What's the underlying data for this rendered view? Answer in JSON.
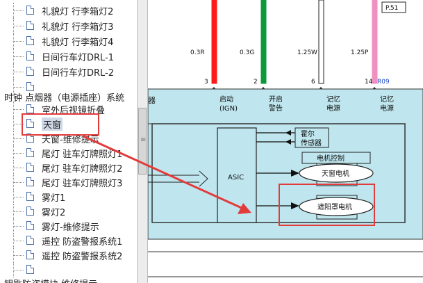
{
  "tree": {
    "items": [
      {
        "label": "礼貌灯 行李箱灯2"
      },
      {
        "label": "礼貌灯 行李箱灯3"
      },
      {
        "label": "礼貌灯 行李箱灯4"
      },
      {
        "label": "日间行车灯DRL-1"
      },
      {
        "label": "日间行车灯DRL-2"
      },
      {
        "label": ""
      }
    ],
    "category": "时钟 点烟器（电源插座）系统",
    "items2": [
      {
        "label": "室外后视镜折叠"
      },
      {
        "label": "天窗"
      },
      {
        "label": "天窗-维修提示"
      },
      {
        "label": "尾灯 驻车灯牌照灯1"
      },
      {
        "label": "尾灯 驻车灯牌照灯2"
      },
      {
        "label": "尾灯 驻车灯牌照灯3"
      },
      {
        "label": "雾灯1"
      },
      {
        "label": "雾灯2"
      },
      {
        "label": "雾灯-维修提示"
      },
      {
        "label": "遥控 防盗警报系统1"
      },
      {
        "label": "遥控 防盗警报系统2"
      },
      {
        "label": ""
      }
    ],
    "bottom_category": "钥匙防盗模块 维修提示"
  },
  "scroll_thumb_glyph": "≡",
  "diagram": {
    "page_ref": "P.51",
    "wires": [
      {
        "gauge": "0.3R",
        "pin": "3",
        "color": "#ff1a1a",
        "label": "启动\n(IGN)"
      },
      {
        "gauge": "0.3G",
        "pin": "2",
        "color": "#0a9a3c",
        "label": "开启\n警告"
      },
      {
        "gauge": "1.25W",
        "pin": "6",
        "color": "#ffffff",
        "label": "记忆\n电源"
      },
      {
        "gauge": "1.25P",
        "pin": "14",
        "color": "#f08fc0",
        "label": "记忆\n电源"
      }
    ],
    "connector": "R09",
    "left_cut_label": "器",
    "asic": "ASIC",
    "hall_sensor": "霍尔\n传感器",
    "motor_control": "电机控制",
    "sunroof_motor": "天窗电机",
    "sunshade_motor": "遮阳罩电机"
  },
  "colors": {
    "module_fill": "#bfe6ee",
    "highlight": "#e23b3b"
  }
}
